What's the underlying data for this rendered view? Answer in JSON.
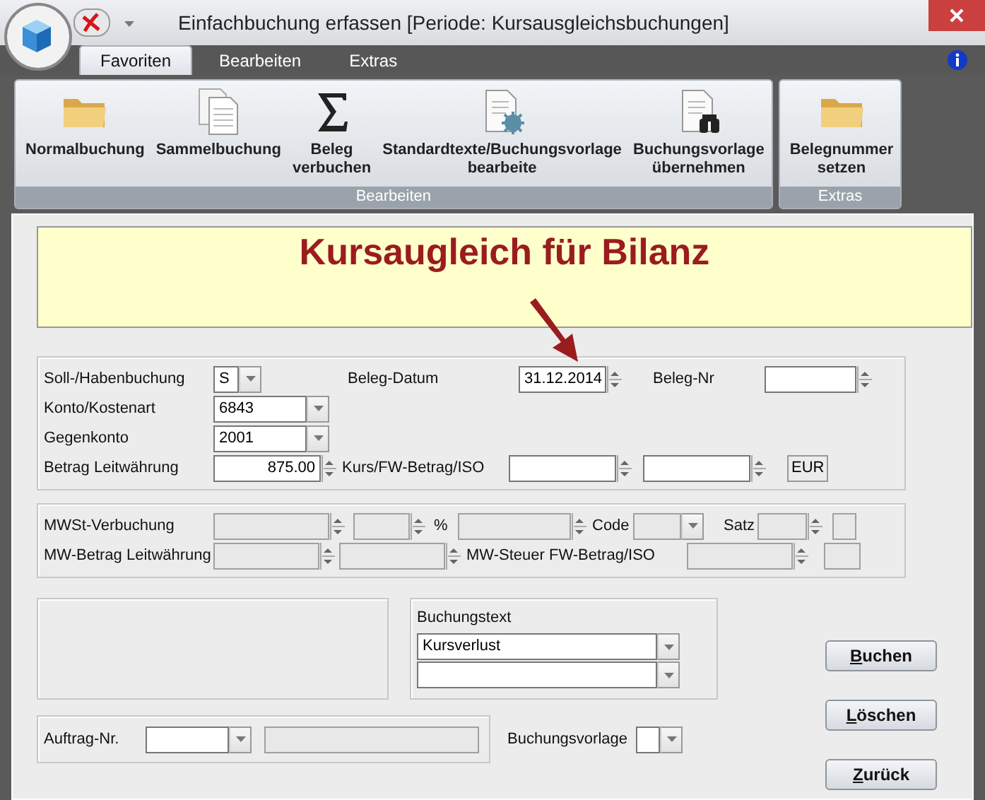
{
  "window": {
    "title": "Einfachbuchung erfassen  [Periode: Kursausgleichsbuchungen]"
  },
  "ribbon": {
    "tabs": [
      {
        "label": "Favoriten",
        "selected": true
      },
      {
        "label": "Bearbeiten",
        "selected": false
      },
      {
        "label": "Extras",
        "selected": false
      }
    ],
    "groups": [
      {
        "label": "Bearbeiten",
        "buttons": [
          {
            "label": "Normalbuchung",
            "kind": "folder"
          },
          {
            "label": "Sammelbuchung",
            "kind": "pages"
          },
          {
            "label": "Beleg\nverbuchen",
            "kind": "sigma"
          },
          {
            "label": "Standardtexte/Buchungsvorlage\nbearbeite",
            "kind": "gear"
          },
          {
            "label": "Buchungsvorlage\nübernehmen",
            "kind": "binoculars"
          }
        ]
      },
      {
        "label": "Extras",
        "buttons": [
          {
            "label": "Belegnummer\nsetzen",
            "kind": "folder"
          }
        ]
      }
    ]
  },
  "banner": {
    "title": "Kursaugleich für Bilanz"
  },
  "booking": {
    "soll_haben": {
      "label": "Soll-/Habenbuchung",
      "value": "S"
    },
    "beleg_datum": {
      "label": "Beleg-Datum",
      "value": "31.12.2014"
    },
    "beleg_nr": {
      "label": "Beleg-Nr"
    },
    "konto": {
      "label": "Konto/Kostenart",
      "value": "6843"
    },
    "gegenkonto": {
      "label": "Gegenkonto",
      "value": "2001"
    },
    "betrag": {
      "label": "Betrag Leitwährung",
      "value": "875.00"
    },
    "kurs": {
      "label": "Kurs/FW-Betrag/ISO",
      "iso": "EUR"
    }
  },
  "tax": {
    "mwst_label": "MWSt-Verbuchung",
    "percent": "%",
    "code_label": "Code",
    "satz_label": "Satz",
    "mw_betrag_label": "MW-Betrag Leitwährung",
    "mw_steuer_label": "MW-Steuer FW-Betrag/ISO",
    "disabled": true
  },
  "text": {
    "label": "Buchungstext",
    "value": "Kursverlust"
  },
  "order": {
    "label": "Auftrag-Nr.",
    "template_label": "Buchungsvorlage"
  },
  "buttons": [
    {
      "label": "Buchen",
      "underline_first": true
    },
    {
      "label": "Löschen",
      "underline_first": true
    },
    {
      "label": "Zurück",
      "underline_first": true
    }
  ]
}
